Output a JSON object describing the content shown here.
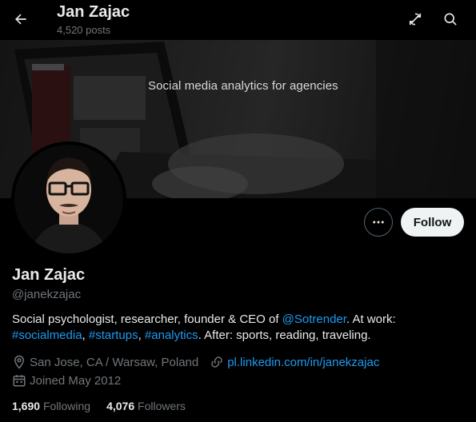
{
  "header": {
    "name": "Jan Zajac",
    "post_count": "4,520 posts",
    "back_icon": "arrow-left-icon",
    "refresh_icon": "reload-icon",
    "search_icon": "search-icon"
  },
  "banner": {
    "tagline": "Social media analytics for agencies"
  },
  "actions": {
    "more_icon": "more-icon",
    "follow_label": "Follow"
  },
  "profile": {
    "display_name": "Jan Zajac",
    "handle": "@janekzajac",
    "bio": {
      "part1": "Social psychologist, researcher, founder & CEO of ",
      "mention": "@Sotrender",
      "part2": ". At work: ",
      "tag1": "#socialmedia",
      "comma1": ", ",
      "tag2": "#startups",
      "comma2": ", ",
      "tag3": "#analytics",
      "part3": ". After: sports, reading, traveling."
    },
    "location": "San Jose, CA / Warsaw, Poland",
    "website": "pl.linkedin.com/in/janekzajac",
    "joined": "Joined May 2012"
  },
  "stats": {
    "following_count": "1,690",
    "following_label": "Following",
    "followers_count": "4,076",
    "followers_label": "Followers"
  },
  "colors": {
    "accent": "#1d9bf0",
    "background": "#000000",
    "text_primary": "#e7e9ea",
    "text_secondary": "#71767b",
    "follow_button_bg": "#eff3f4"
  }
}
